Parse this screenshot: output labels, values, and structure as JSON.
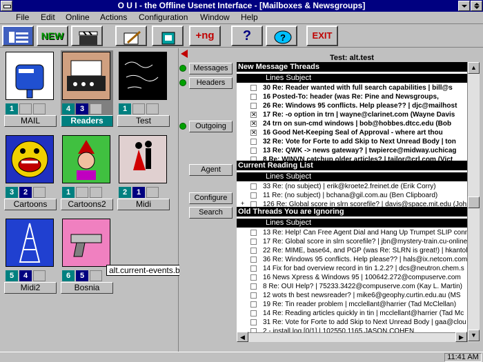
{
  "window": {
    "title": "O U I - the Offline Usenet Interface - [Mailboxes & Newsgroups]"
  },
  "menu": [
    "File",
    "Edit",
    "Online",
    "Actions",
    "Configuration",
    "Window",
    "Help"
  ],
  "toolbar": {
    "new_label": "NEW",
    "ng_label": "+ng",
    "help_label": "?",
    "exit_label": "EXIT"
  },
  "folders": [
    {
      "name": "MAIL",
      "counts": [
        "1",
        "",
        ""
      ]
    },
    {
      "name": "Readers",
      "counts": [
        "4",
        "3",
        ""
      ]
    },
    {
      "name": "Test",
      "counts": [
        "1",
        "",
        ""
      ]
    },
    {
      "name": "Cartoons",
      "counts": [
        "3",
        "2",
        ""
      ]
    },
    {
      "name": "Cartoons2",
      "counts": [
        "1",
        "",
        ""
      ]
    },
    {
      "name": "Midi",
      "counts": [
        "2",
        "1",
        ""
      ]
    },
    {
      "name": "Midi2",
      "counts": [
        "5",
        "4",
        ""
      ]
    },
    {
      "name": "Bosnia",
      "counts": [
        "6",
        "5",
        ""
      ]
    }
  ],
  "tooltip": "alt.current-events.bosnia",
  "side_buttons": {
    "messages": "Messages",
    "headers": "Headers",
    "outgoing": "Outgoing",
    "agent": "Agent",
    "configure": "Configure",
    "search": "Search"
  },
  "group": "Test: alt.test",
  "sections": {
    "new_threads": "New Message Threads",
    "reading_list": "Current Reading List",
    "ignoring": "Old Threads You are Ignoring",
    "col_header": "Lines Subject"
  },
  "new_threads": [
    {
      "text": "30 Re: Reader wanted with full search capabilities | bill@s",
      "mark": ""
    },
    {
      "text": "16 Posted-To: header (was Re: Pine and Newsgroups,",
      "mark": ""
    },
    {
      "text": "26 Re: Windows 95 conflicts. Help please?? | djc@mailhost",
      "mark": ""
    },
    {
      "text": "17 Re: -o option in trn | wayne@clarinet.com (Wayne Davis",
      "mark": "x"
    },
    {
      "text": "24 trn on sun-cmd windows | bob@hobbes.dtcc.edu (Bob",
      "mark": "x"
    },
    {
      "text": "16 Good Net-Keeping Seal of Approval - where art thou",
      "mark": "x"
    },
    {
      "text": "32 Re: Vote for Forte to add Skip to Next Unread Body | ton",
      "mark": ""
    },
    {
      "text": "13 Re: QWK -> news gateway? | twpierce@midway.uchicag",
      "mark": ""
    },
    {
      "text": "8 Re: WINVN catchup older articles? | tailor@crl.com (Vict",
      "mark": ""
    }
  ],
  "reading_list": [
    {
      "text": "33 Re: (no subject) | erik@kroete2.freinet.de (Erik Corry)",
      "mark": ""
    },
    {
      "text": "11 Re: (no subject) | bchana@gil.com.au (Ben Clipboard)",
      "mark": ""
    },
    {
      "text": "126 Re: Global score in slrn scorefile? | davis@space.mit.edu (John",
      "mark": "+"
    }
  ],
  "ignoring": [
    "13 Re: Help!  Can Free Agent Dial and Hang Up Trumpet SLIP conn",
    "17 Re: Global score in slrn scorefile? | jbn@mystery-train.cu-online",
    "22 Re: MIME, base64, and PGP (was Re: SLRN is great!) | hkantola",
    "36 Re: Windows 95 conflicts. Help please?? | hals@ix.netcom.com",
    "14 Fix for bad overview record in tin 1.2.2? | dcs@neutron.chem.s",
    "16 News Xpress & Windows 95 | 100642.272@compuserve.com",
    "8 Re: OUI Help? | 75233.3422@compuserve.com (Kay L. Martin)",
    "12 wots th best newsreader? | mike6@geophy.curtin.edu.au (MS",
    "19 Re: Tin reader problem | mcclellant@harrier (Tad McClellan)",
    "14 Re: Reading articles quickly in tin | mcclellant@harrier (Tad Mc",
    "31 Re: Vote for Forte to add Skip to Next Unread Body | gaa@clou",
    "2 - install.log [0/1] | 102550.1165 JASON COHEN"
  ],
  "clock": "11:41 AM"
}
